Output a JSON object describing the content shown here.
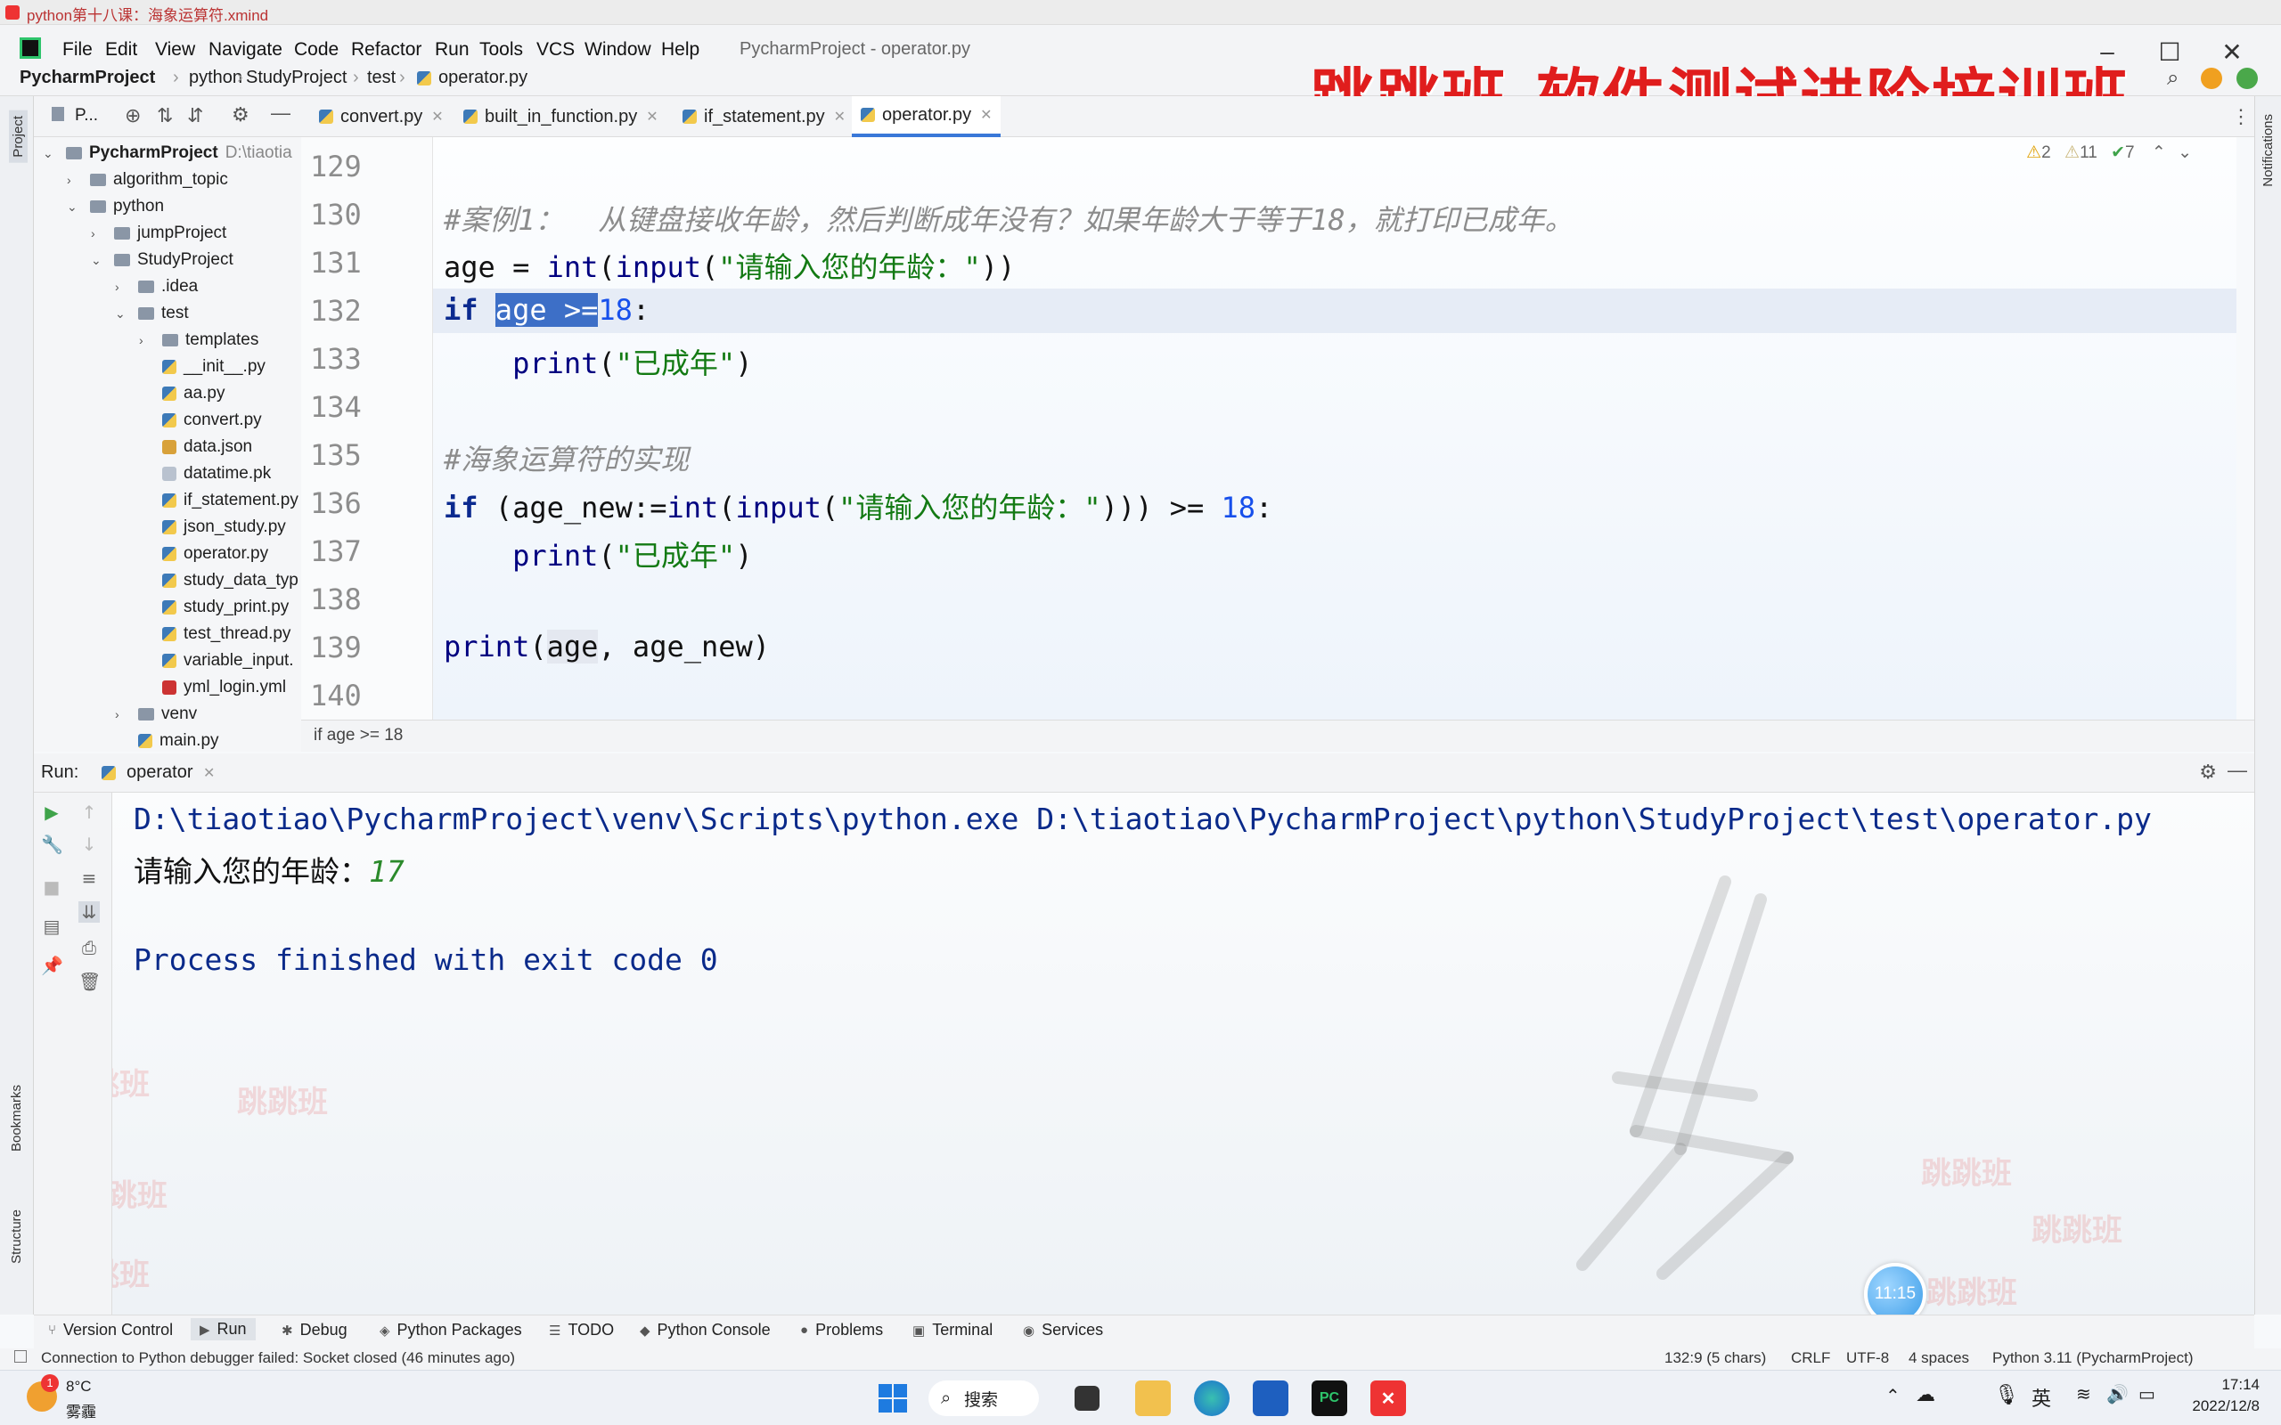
{
  "xmind_title": "python第十八课：海象运算符.xmind",
  "menu": [
    "File",
    "Edit",
    "View",
    "Navigate",
    "Code",
    "Refactor",
    "Run",
    "Tools",
    "VCS",
    "Window",
    "Help"
  ],
  "window_title": "PycharmProject - operator.py",
  "breadcrumb": [
    "PycharmProject",
    "python",
    "StudyProject",
    "test",
    "operator.py"
  ],
  "banner": "跳跳班-软件测试进阶培训班",
  "project_panel": {
    "title": "P...",
    "root": "PycharmProject",
    "root_path": "D:\\tiaotia",
    "items": [
      {
        "label": "algorithm_topic",
        "type": "folder",
        "level": 1,
        "arrow": "›"
      },
      {
        "label": "python",
        "type": "folder",
        "level": 1,
        "arrow": "⌄"
      },
      {
        "label": "jumpProject",
        "type": "folder",
        "level": 2,
        "arrow": "›"
      },
      {
        "label": "StudyProject",
        "type": "folder",
        "level": 2,
        "arrow": "⌄"
      },
      {
        "label": ".idea",
        "type": "folder",
        "level": 3,
        "arrow": "›"
      },
      {
        "label": "test",
        "type": "folder",
        "level": 3,
        "arrow": "⌄"
      },
      {
        "label": "templates",
        "type": "folder",
        "level": 4,
        "arrow": "›"
      },
      {
        "label": "__init__.py",
        "type": "py",
        "level": 4,
        "arrow": ""
      },
      {
        "label": "aa.py",
        "type": "py",
        "level": 4,
        "arrow": ""
      },
      {
        "label": "convert.py",
        "type": "py",
        "level": 4,
        "arrow": ""
      },
      {
        "label": "data.json",
        "type": "json",
        "level": 4,
        "arrow": ""
      },
      {
        "label": "datatime.pk",
        "type": "gen",
        "level": 4,
        "arrow": ""
      },
      {
        "label": "if_statement.py",
        "type": "py",
        "level": 4,
        "arrow": ""
      },
      {
        "label": "json_study.py",
        "type": "py",
        "level": 4,
        "arrow": ""
      },
      {
        "label": "operator.py",
        "type": "py",
        "level": 4,
        "arrow": ""
      },
      {
        "label": "study_data_typ",
        "type": "py",
        "level": 4,
        "arrow": ""
      },
      {
        "label": "study_print.py",
        "type": "py",
        "level": 4,
        "arrow": ""
      },
      {
        "label": "test_thread.py",
        "type": "py",
        "level": 4,
        "arrow": ""
      },
      {
        "label": "variable_input.",
        "type": "py",
        "level": 4,
        "arrow": ""
      },
      {
        "label": "yml_login.yml",
        "type": "yml",
        "level": 4,
        "arrow": ""
      },
      {
        "label": "venv",
        "type": "folder",
        "level": 3,
        "arrow": "›"
      },
      {
        "label": "main.py",
        "type": "py",
        "level": 3,
        "arrow": ""
      }
    ]
  },
  "tabs": [
    {
      "label": "convert.py",
      "active": false
    },
    {
      "label": "built_in_function.py",
      "active": false
    },
    {
      "label": "if_statement.py",
      "active": false
    },
    {
      "label": "operator.py",
      "active": true
    }
  ],
  "inspections": {
    "warn_a": "2",
    "warn_b": "11",
    "ok": "7"
  },
  "line_numbers": [
    "129",
    "130",
    "131",
    "132",
    "133",
    "134",
    "135",
    "136",
    "137",
    "138",
    "139",
    "140"
  ],
  "code_crumb": "if age >= 18",
  "run_panel": {
    "label": "Run:",
    "tab": "operator"
  },
  "console": {
    "cmd": "D:\\tiaotiao\\PycharmProject\\venv\\Scripts\\python.exe D:\\tiaotiao\\PycharmProject\\python\\StudyProject\\test\\operator.py",
    "prompt": "请输入您的年龄：",
    "input": "17",
    "finish": "Process finished with exit code 0"
  },
  "watermark": "跳跳班",
  "bubble_time": "11:15",
  "left_vertical": [
    "Project",
    "Bookmarks",
    "Structure"
  ],
  "right_vertical": "Notifications",
  "bottom_tabs": [
    "Version Control",
    "Run",
    "Debug",
    "Python Packages",
    "TODO",
    "Python Console",
    "Problems",
    "Terminal",
    "Services"
  ],
  "status": {
    "left": "Connection to Python debugger failed: Socket closed (46 minutes ago)",
    "pos": "132:9 (5 chars)",
    "crlf": "CRLF",
    "enc": "UTF-8",
    "indent": "4 spaces",
    "interp": "Python 3.11 (PycharmProject)"
  },
  "taskbar": {
    "weather_temp": "8°C",
    "weather_desc": "雾霾",
    "badge": "1",
    "search": "搜索",
    "ime": "英",
    "time": "17:14",
    "date": "2022/12/8"
  }
}
